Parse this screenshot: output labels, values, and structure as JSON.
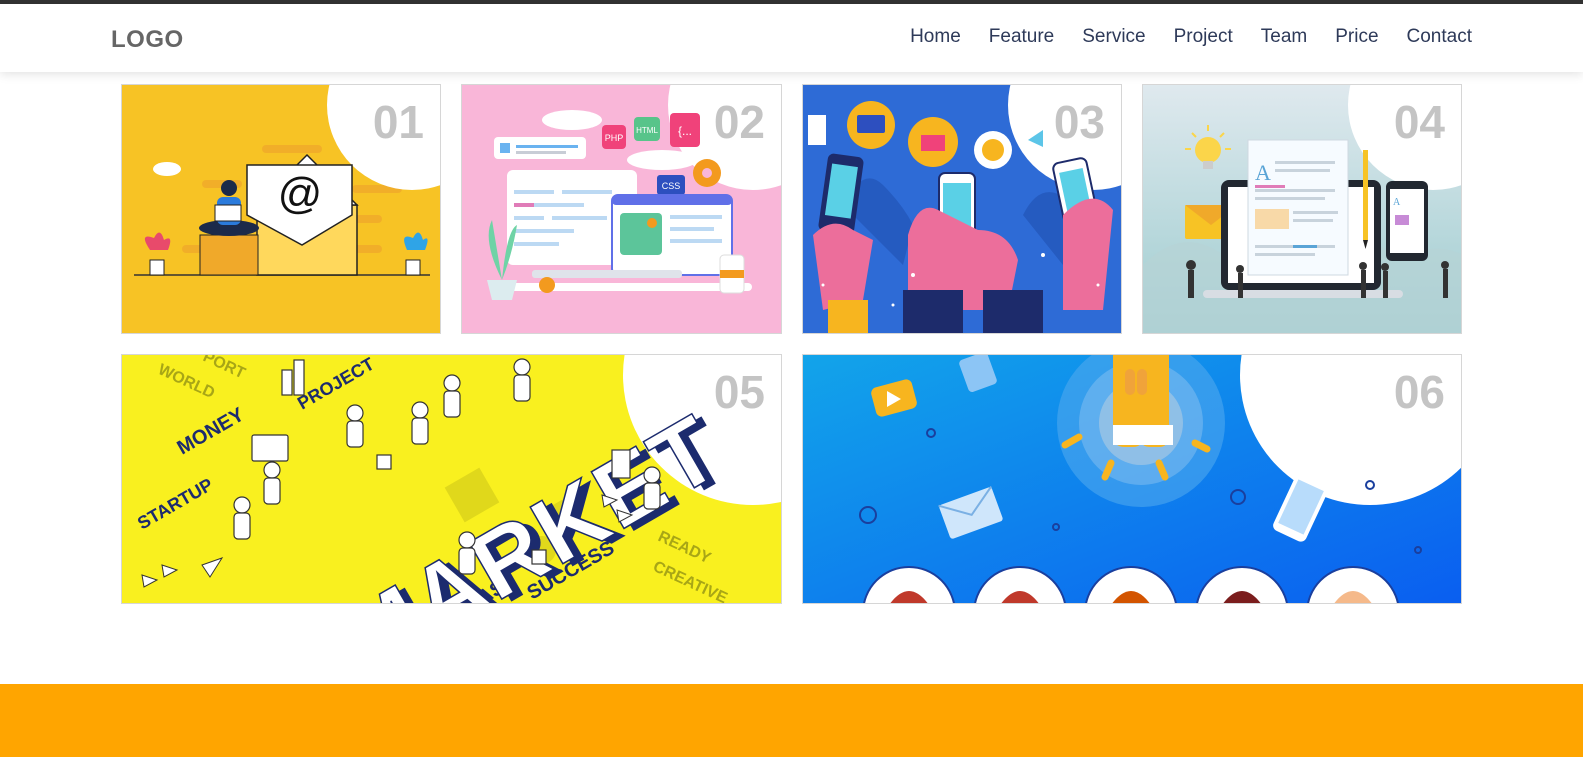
{
  "header": {
    "logo": "LOGO",
    "nav": [
      "Home",
      "Feature",
      "Service",
      "Project",
      "Team",
      "Price",
      "Contact"
    ]
  },
  "cards": [
    {
      "number": "01",
      "icon": "email-marketing-illustration",
      "email_symbol": "@"
    },
    {
      "number": "02",
      "icon": "web-development-illustration",
      "tags": [
        "PHP",
        "HTML",
        "CSS",
        "{..."
      ]
    },
    {
      "number": "03",
      "icon": "mobile-shopping-illustration"
    },
    {
      "number": "04",
      "icon": "content-writing-illustration",
      "letter": "A"
    },
    {
      "number": "05",
      "icon": "marketing-isometric-illustration",
      "words": [
        "MARKET",
        "MONEY",
        "PROJECT",
        "STARTUP",
        "SUCCESS",
        "WORLD",
        "PORT",
        "READY",
        "CREATIVE",
        "AS"
      ]
    },
    {
      "number": "06",
      "icon": "team-magnet-illustration"
    }
  ],
  "colors": {
    "footer": "#ffa500",
    "nav_text": "#2e3a59",
    "logo": "#666666",
    "card_number": "#c4c4c4"
  }
}
